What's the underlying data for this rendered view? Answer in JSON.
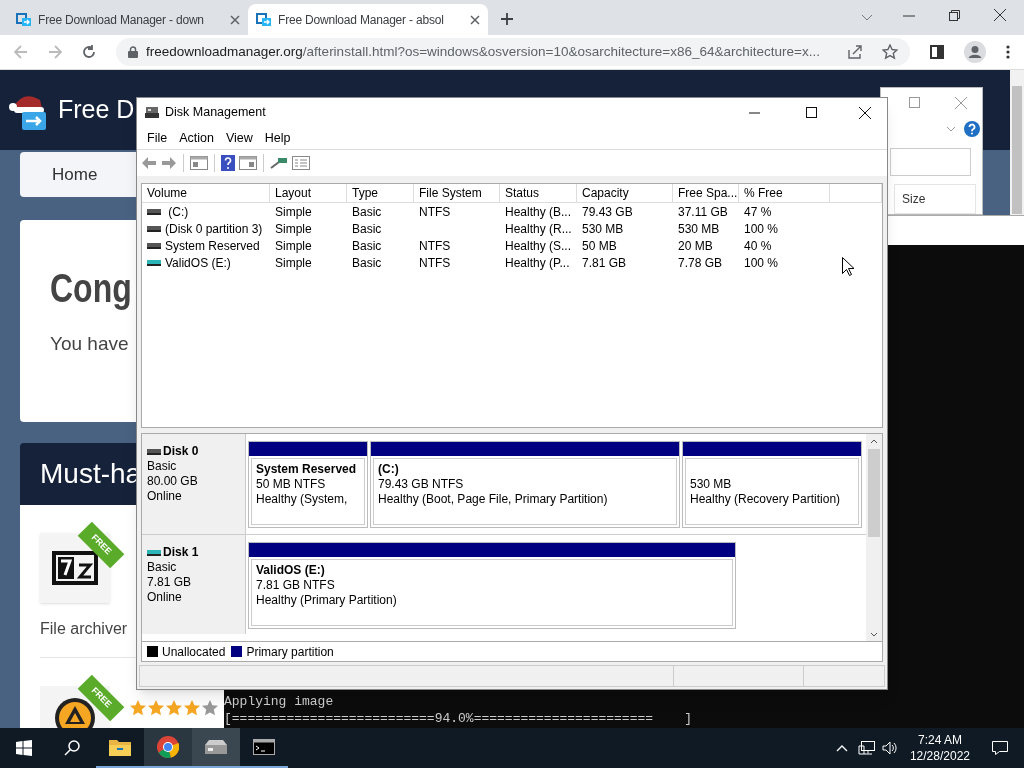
{
  "browser": {
    "tabs": [
      {
        "title": "Free Download Manager - down",
        "selected": false
      },
      {
        "title": "Free Download Manager - absol",
        "selected": true
      }
    ],
    "url_host": "freedownloadmanager.org",
    "url_path": "/afterinstall.html?os=windows&osversion=10&osarchitecture=x86_64&architecture=x..."
  },
  "website": {
    "logo_text": "Free D",
    "nav": [
      "Home"
    ],
    "heading": "Cong",
    "subtext": "You have",
    "section_title": "Must-ha",
    "apps": [
      {
        "badge": "FREE",
        "caption": "File archiver"
      },
      {
        "badge": "FREE",
        "stars": 4
      }
    ]
  },
  "background_window": {
    "column": "Size"
  },
  "disk_management": {
    "title": "Disk Management",
    "menu": [
      "File",
      "Action",
      "View",
      "Help"
    ],
    "columns": [
      "Volume",
      "Layout",
      "Type",
      "File System",
      "Status",
      "Capacity",
      "Free Spa...",
      "% Free"
    ],
    "volumes": [
      {
        "kind": "fixed",
        "volume": " (C:)",
        "layout": "Simple",
        "type": "Basic",
        "file_system": "NTFS",
        "status": "Healthy (B...",
        "capacity": "79.43 GB",
        "free_space": "37.11 GB",
        "percent_free": "47 %"
      },
      {
        "kind": "fixed",
        "volume": "(Disk 0 partition 3)",
        "layout": "Simple",
        "type": "Basic",
        "status": "Healthy (R...",
        "capacity": "530 MB",
        "free_space": "530 MB",
        "percent_free": "100 %"
      },
      {
        "kind": "fixed",
        "volume": "System Reserved",
        "layout": "Simple",
        "type": "Basic",
        "file_system": "NTFS",
        "status": "Healthy (S...",
        "capacity": "50 MB",
        "free_space": "20 MB",
        "percent_free": "40 %"
      },
      {
        "kind": "removable",
        "volume": "ValidOS (E:)",
        "layout": "Simple",
        "type": "Basic",
        "file_system": "NTFS",
        "status": "Healthy (P...",
        "capacity": "7.81 GB",
        "free_space": "7.78 GB",
        "percent_free": "100 %"
      }
    ],
    "disks": [
      {
        "kind": "fixed",
        "name": "Disk 0",
        "type": "Basic",
        "size": "80.00 GB",
        "status": "Online",
        "partitions": [
          {
            "name": "System Reserved",
            "detail": "50 MB NTFS",
            "status": "Healthy (System,"
          },
          {
            "name": "(C:)",
            "detail": "79.43 GB NTFS",
            "status": "Healthy (Boot, Page File, Primary Partition)"
          },
          {
            "detail": "530 MB",
            "status": "Healthy (Recovery Partition)"
          }
        ]
      },
      {
        "kind": "removable",
        "name": "Disk 1",
        "type": "Basic",
        "size": "7.81 GB",
        "status": "Online",
        "partitions": [
          {
            "name": "ValidOS  (E:)",
            "detail": "7.81 GB NTFS",
            "status": "Healthy (Primary Partition)"
          }
        ]
      }
    ],
    "legend": [
      {
        "label": "Unallocated",
        "color": "#000000"
      },
      {
        "label": "Primary partition",
        "color": "#000080"
      }
    ]
  },
  "console": {
    "lines": [
      "Applying image",
      "[==========================94.0%=======================    ]"
    ]
  },
  "taskbar": {
    "time": "7:24 AM",
    "date": "12/28/2022"
  }
}
